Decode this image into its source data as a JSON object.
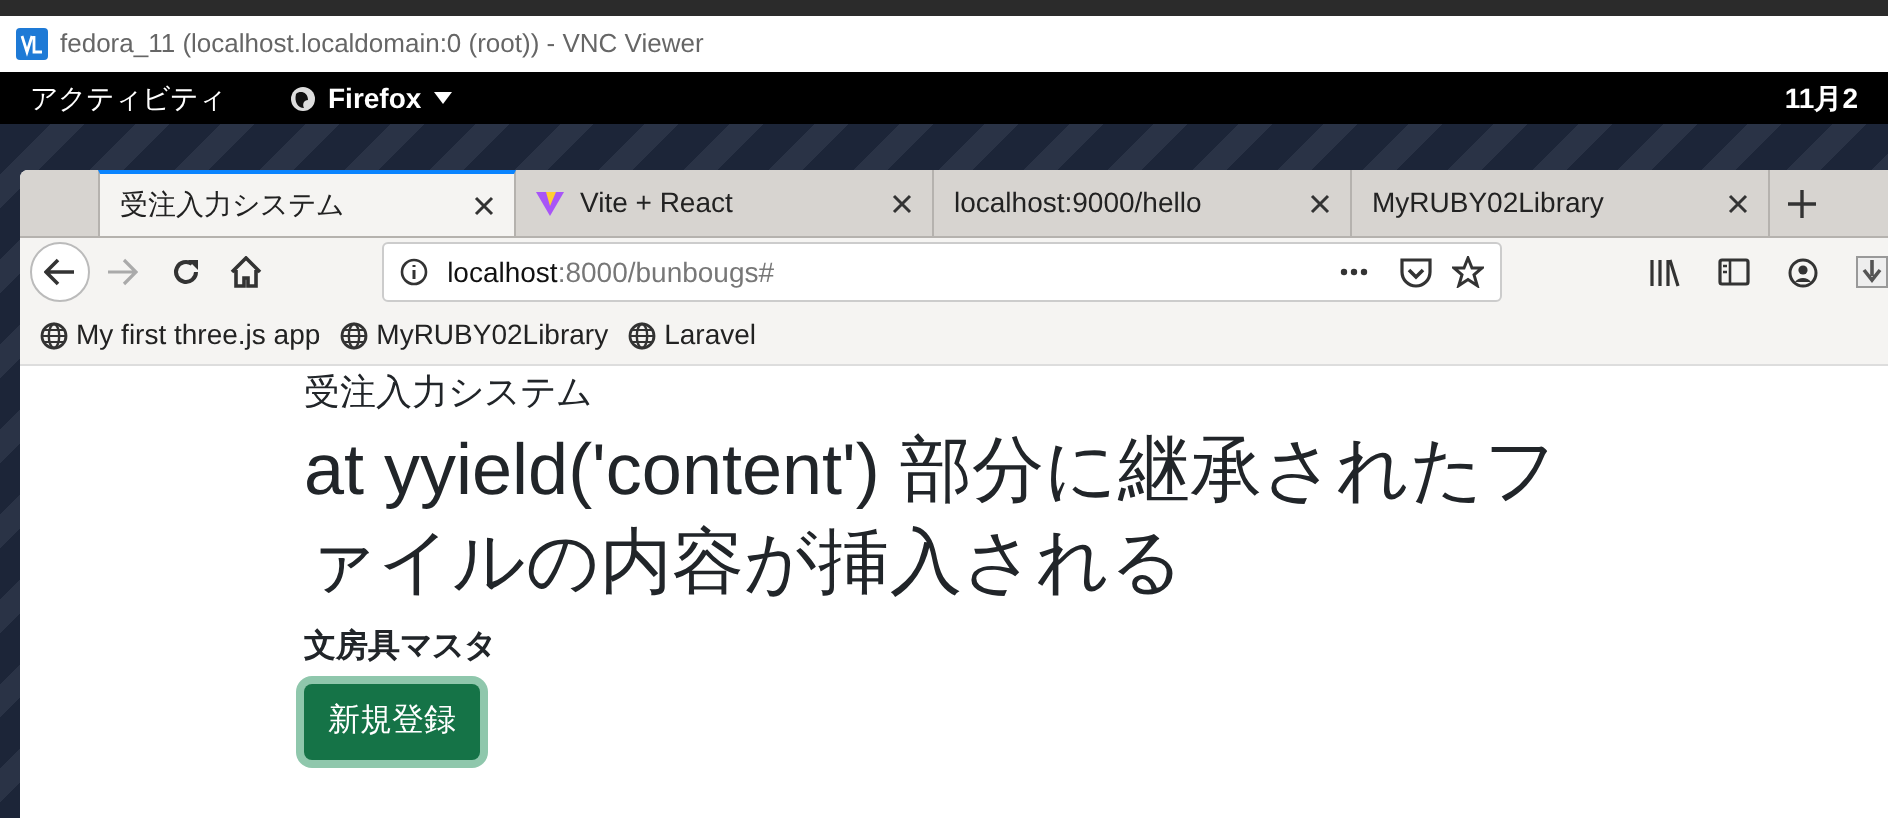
{
  "vnc_window": {
    "title": "fedora_11 (localhost.localdomain:0 (root)) - VNC Viewer"
  },
  "top_bar": {
    "activities": "アクティビティ",
    "app": "Firefox",
    "clock": "11月2"
  },
  "tabs": [
    {
      "label": "受注入力システム",
      "selected": true,
      "kind": "plain"
    },
    {
      "label": "Vite + React",
      "selected": false,
      "kind": "vite"
    },
    {
      "label": "localhost:9000/hello",
      "selected": false,
      "kind": "plain"
    },
    {
      "label": "MyRUBY02Library",
      "selected": false,
      "kind": "plain"
    }
  ],
  "url_bar": {
    "host": "localhost",
    "path": ":8000/bunbougs#"
  },
  "bookmarks": [
    "My first three.js app",
    "MyRUBY02Library",
    "Laravel"
  ],
  "page": {
    "site_title": "受注入力システム",
    "heading": "at yyield('content') 部分に継承されたファイルの内容が挿入される",
    "subheading": "文房具マスタ",
    "button": "新規登録"
  }
}
